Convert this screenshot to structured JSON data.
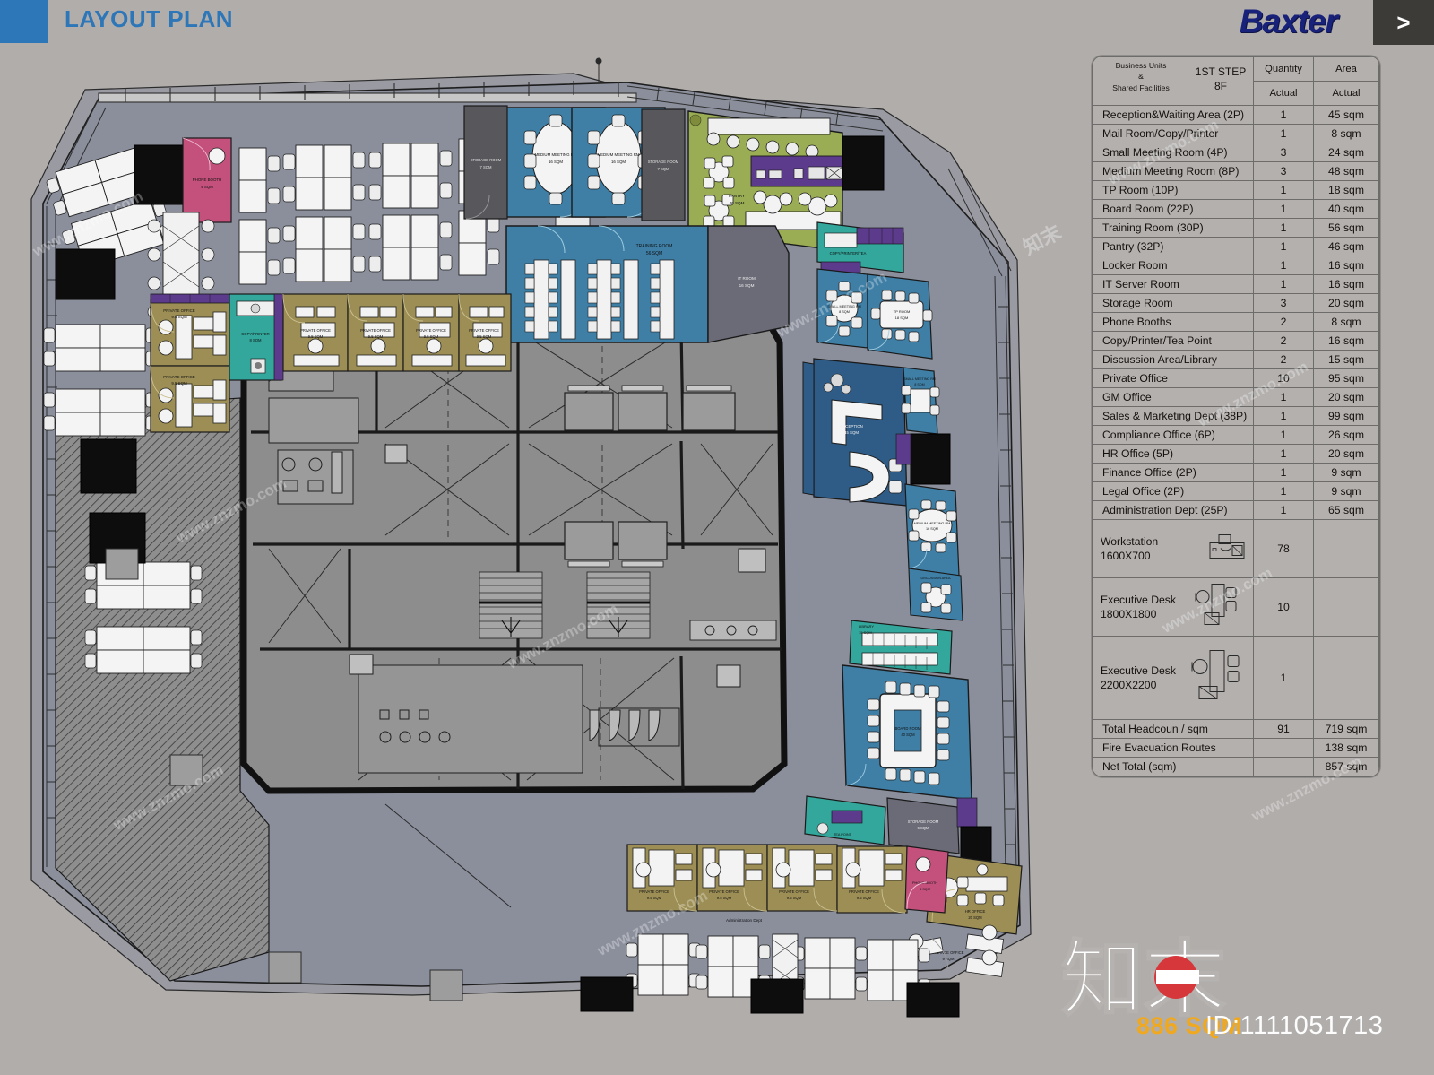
{
  "header": {
    "title": "LAYOUT PLAN",
    "brand": "Baxter",
    "next_label": ">",
    "accent_color": "#2d76b8",
    "brand_color": "#19227a"
  },
  "spec_table": {
    "header": {
      "business_units_line1": "Business Units",
      "business_units_line2": "&",
      "business_units_line3": "Shared Facilities",
      "step_line1": "1ST STEP",
      "step_line2": "8F",
      "quantity": "Quantity",
      "area": "Area",
      "quantity_sub": "Actual",
      "area_sub": "Actual"
    },
    "rows": [
      {
        "label": "Reception&Waiting Area (2P)",
        "qty": "1",
        "area": "45 sqm"
      },
      {
        "label": "Mail Room/Copy/Printer",
        "qty": "1",
        "area": "8 sqm"
      },
      {
        "label": "Small Meeting Room  (4P)",
        "qty": "3",
        "area": "24 sqm"
      },
      {
        "label": "Medium Meeting Room  (8P)",
        "qty": "3",
        "area": "48 sqm"
      },
      {
        "label": "TP Room (10P)",
        "qty": "1",
        "area": "18 sqm"
      },
      {
        "label": "Board Room  (22P)",
        "qty": "1",
        "area": "40 sqm"
      },
      {
        "label": "Training Room  (30P)",
        "qty": "1",
        "area": "56 sqm"
      },
      {
        "label": "Pantry  (32P)",
        "qty": "1",
        "area": "46 sqm"
      },
      {
        "label": "Locker Room",
        "qty": "1",
        "area": "16 sqm"
      },
      {
        "label": "IT Server Room",
        "qty": "1",
        "area": "16 sqm"
      },
      {
        "label": "Storage Room",
        "qty": "3",
        "area": "20 sqm"
      },
      {
        "label": "Phone Booths",
        "qty": "2",
        "area": "8 sqm"
      },
      {
        "label": "Copy/Printer/Tea Point",
        "qty": "2",
        "area": "16 sqm"
      },
      {
        "label": "Discussion Area/Library",
        "qty": "2",
        "area": "15 sqm"
      },
      {
        "label": "Private Office",
        "qty": "10",
        "area": "95 sqm"
      },
      {
        "label": "GM Office",
        "qty": "1",
        "area": "20 sqm"
      },
      {
        "label": "Sales & Marketing Dept  (38P)",
        "qty": "1",
        "area": "99 sqm"
      },
      {
        "label": "Compliance Office  (6P)",
        "qty": "1",
        "area": "26 sqm"
      },
      {
        "label": "HR  Office  (5P)",
        "qty": "1",
        "area": "20 sqm"
      },
      {
        "label": "Finance  Office  (2P)",
        "qty": "1",
        "area": "9 sqm"
      },
      {
        "label": "Legal  Office  (2P)",
        "qty": "1",
        "area": "9 sqm"
      },
      {
        "label": "Administration Dept  (25P)",
        "qty": "1",
        "area": "65 sqm"
      }
    ],
    "furniture_rows": [
      {
        "label_line1": "Workstation",
        "label_line2": "1600X700",
        "qty": "78",
        "area": "",
        "icon": "workstation-icon"
      },
      {
        "label_line1": "Executive Desk",
        "label_line2": "1800X1800",
        "qty": "10",
        "area": "",
        "icon": "executive-desk-small-icon"
      },
      {
        "label_line1": "Executive Desk",
        "label_line2": "2200X2200",
        "qty": "1",
        "area": "",
        "icon": "executive-desk-large-icon"
      }
    ],
    "total_rows": [
      {
        "label": "Total Headcoun / sqm",
        "qty": "91",
        "area": "719 sqm"
      },
      {
        "label": "Fire Evacuation Routes",
        "qty": "",
        "area": "138 sqm"
      },
      {
        "label": "Net Total (sqm)",
        "qty": "",
        "area": "857 sqm"
      }
    ]
  },
  "footer": {
    "sqm_note": "886 SQM",
    "id_note": "ID:1111051713"
  },
  "watermarks": {
    "site_text": "www.znzmo.com",
    "logo_text": "知末"
  },
  "plan": {
    "zone_colors": {
      "floor_grey": "#8b8f9c",
      "core_grey": "#8d8d8d",
      "meeting_blue": "#3f7fa6",
      "office_blue": "#2f5c86",
      "reception_blue": "#4a8fb5",
      "pantry_green": "#9aad55",
      "private_office_gold": "#9c8e55",
      "phone_booth_pink": "#c4517c",
      "teapoint_teal": "#33a79c",
      "storage_purple": "#5c3a8c",
      "dark_core": "#58585c",
      "hatched_grey": "#8e8e8e",
      "black_fill": "#0d0d0d"
    },
    "rooms": [
      {
        "name": "PHONE BOOTH",
        "area": "4 SQM",
        "zone": "phone-booth-pink"
      },
      {
        "name": "PRIVATE OFFICE",
        "area": "9.5 SQM",
        "zone": "private-office-gold"
      },
      {
        "name": "COPY/PRINTER",
        "area": "8 SQM",
        "zone": "teapoint-teal"
      },
      {
        "name": "MEDIUM MEETING ROOM",
        "area": "16 SQM",
        "zone": "meeting-blue"
      },
      {
        "name": "TRAINING ROOM",
        "area": "56 SQM",
        "zone": "meeting-blue"
      },
      {
        "name": "PANTRY",
        "area": "46 SQM",
        "zone": "pantry-green"
      },
      {
        "name": "IT SERVER ROOM",
        "area": "16 SQM",
        "zone": "dark-core"
      },
      {
        "name": "BOARD ROOM",
        "area": "40 SQM",
        "zone": "meeting-blue"
      },
      {
        "name": "RECEPTION & WAITING AREA",
        "area": "45 SQM",
        "zone": "reception-blue"
      },
      {
        "name": "GM OFFICE",
        "area": "20 SQM",
        "zone": "office-blue"
      },
      {
        "name": "SMALL MEETING ROOM",
        "area": "8 SQM",
        "zone": "meeting-blue"
      },
      {
        "name": "TP ROOM",
        "area": "18 SQM",
        "zone": "meeting-blue"
      },
      {
        "name": "LOCKER ROOM",
        "area": "16 SQM",
        "zone": "dark-core"
      },
      {
        "name": "STORAGE ROOM",
        "area": "7 SQM",
        "zone": "dark-core"
      },
      {
        "name": "FINANCE OFFICE",
        "area": "9 SQM",
        "zone": "floor-grey"
      },
      {
        "name": "LEGAL OFFICE",
        "area": "9 SQM",
        "zone": "floor-grey"
      },
      {
        "name": "HR OFFICE",
        "area": "20 SQM",
        "zone": "private-office-gold"
      },
      {
        "name": "SALES & MARKETING DEPT",
        "area": "99 SQM",
        "zone": "floor-grey"
      },
      {
        "name": "ADMINISTRATION DEPT",
        "area": "65 SQM",
        "zone": "floor-grey"
      },
      {
        "name": "DISCUSSION AREA/LIBRARY",
        "area": "15 SQM",
        "zone": "reception-blue"
      },
      {
        "name": "COMPLIANCE OFFICE",
        "area": "26 SQM",
        "zone": "office-blue"
      }
    ]
  }
}
